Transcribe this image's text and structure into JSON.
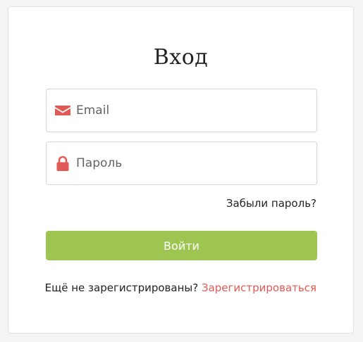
{
  "login": {
    "title": "Вход",
    "email_placeholder": "Email",
    "password_placeholder": "Пароль",
    "forgot_label": "Забыли пароль?",
    "submit_label": "Войти",
    "register_prompt": "Ещё не зарегистрированы?",
    "register_link": "Зарегистрироваться"
  },
  "icons": {
    "email": "envelope-icon",
    "password": "lock-icon"
  },
  "colors": {
    "accent_red": "#e05a57",
    "button_green": "#9ec552"
  }
}
